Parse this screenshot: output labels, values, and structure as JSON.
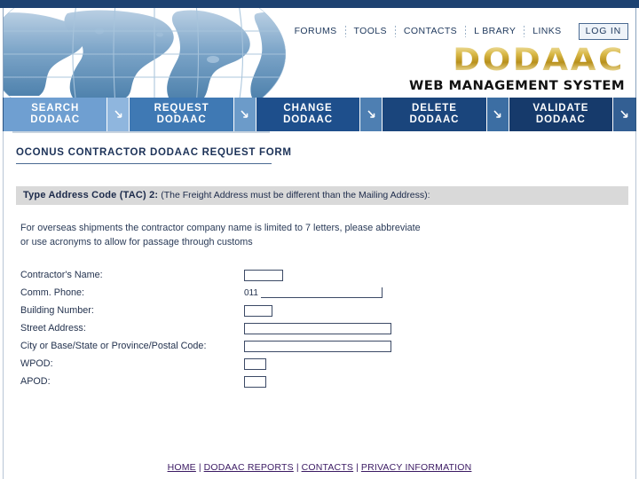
{
  "site": {
    "logo_main": "DODAAC",
    "logo_sub": "WEB MANAGEMENT SYSTEM",
    "logo_color": "#c8a331",
    "topbar_color": "#1d4271"
  },
  "topnav": {
    "items": [
      {
        "label": "FORUMS"
      },
      {
        "label": "TOOLS"
      },
      {
        "label": "CONTACTS"
      },
      {
        "label": "L BRARY"
      },
      {
        "label": "LINKS"
      }
    ],
    "login_label": "LOG IN"
  },
  "tabs": [
    {
      "line1": "SEARCH",
      "line2": "DODAAC",
      "color": "#6f9fd1",
      "arrow_bg": "#8fb6de",
      "arrow_color": "#ffffff"
    },
    {
      "line1": "REQUEST",
      "line2": "DODAAC",
      "color": "#3f79b4",
      "arrow_bg": "#6c9bc9",
      "arrow_color": "#ffffff"
    },
    {
      "line1": "CHANGE",
      "line2": "DODAAC",
      "color": "#1e4f8c",
      "arrow_bg": "#4e7fb2",
      "arrow_color": "#ffffff"
    },
    {
      "line1": "DELETE",
      "line2": "DODAAC",
      "color": "#1a457c",
      "arrow_bg": "#3c6ea3",
      "arrow_color": "#ffffff"
    },
    {
      "line1": "VALIDATE",
      "line2": "DODAAC",
      "color": "#163a6b",
      "arrow_bg": "#335f93",
      "arrow_color": "#ffffff"
    }
  ],
  "form": {
    "title": "OCONUS CONTRACTOR DODAAC REQUEST FORM",
    "tac_heading_bold": "Type Address Code (TAC) 2:",
    "tac_heading_rest": "(The Freight Address must be different than the Mailing Address):",
    "instructions_line1": "For overseas shipments the contractor company name is limited to 7 letters, please abbreviate",
    "instructions_line2": "or use acronyms to allow for passage through customs",
    "fields": {
      "contractor_name": {
        "label": "Contractor's Name:",
        "value": ""
      },
      "comm_phone": {
        "label": "Comm. Phone:",
        "prefix": "011",
        "value": ""
      },
      "building_number": {
        "label": "Building Number:",
        "value": ""
      },
      "street_address": {
        "label": "Street Address:",
        "value": ""
      },
      "city_state_postal": {
        "label": "City or Base/State or Province/Postal Code:",
        "value": ""
      },
      "wpod": {
        "label": "WPOD:",
        "value": ""
      },
      "apod": {
        "label": "APOD:",
        "value": ""
      }
    }
  },
  "footer": {
    "links": [
      {
        "label": "HOME"
      },
      {
        "label": "DODAAC REPORTS"
      },
      {
        "label": "CONTACTS"
      },
      {
        "label": "PRIVACY INFORMATION"
      }
    ],
    "separator": "|",
    "link_color": "#3b1a63"
  }
}
